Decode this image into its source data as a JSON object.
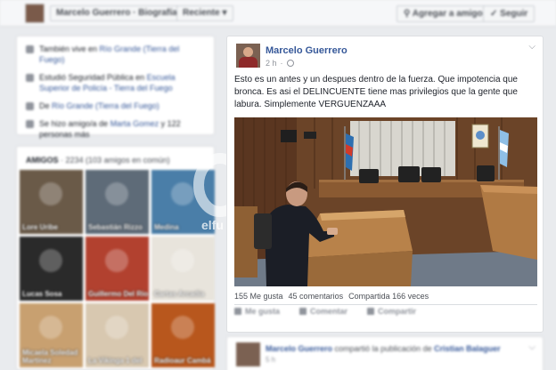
{
  "topbar": {
    "profile_name": "Marcelo Guerrero",
    "section": "Biografía",
    "sort": "Reciente",
    "add_friend": "Agregar a amigos",
    "follow": "Seguir"
  },
  "intro": [
    {
      "pre": "También vive en ",
      "link": "Río Grande (Tierra del Fuego)",
      "post": ""
    },
    {
      "pre": "Estudió Seguridad Pública en ",
      "link": "Escuela Superior de Policía - Tierra del Fuego",
      "post": ""
    },
    {
      "pre": "De ",
      "link": "Río Grande (Tierra del Fuego)",
      "post": ""
    },
    {
      "pre": "Se hizo amigo/a de ",
      "link": "Marta Gomez",
      "post": " y 122 personas más"
    }
  ],
  "friends": {
    "title": "AMIGOS",
    "count": "2234 (103 amigos en común)",
    "items": [
      {
        "name": "Lore Uribe",
        "color": "#6a5a48"
      },
      {
        "name": "Sebastián Rizzo",
        "color": "#5e6b78"
      },
      {
        "name": "Medina",
        "color": "#4a7ea8"
      },
      {
        "name": "Lucas Sosa",
        "color": "#2a2a2a"
      },
      {
        "name": "Guillermo Del Río",
        "color": "#b2412f"
      },
      {
        "name": "Cartas Arcadia",
        "color": "#e8e4dc"
      },
      {
        "name": "Micaela Soledad Martínez",
        "color": "#c8a070"
      },
      {
        "name": "La Vikinga 1 del",
        "color": "#d8c8b0"
      },
      {
        "name": "Radioaur Cambá",
        "color": "#b8571d"
      }
    ]
  },
  "post": {
    "author": "Marcelo Guerrero",
    "time": "2 h",
    "text": "Esto es un antes y un despues dentro de la fuerza. Que impotencia que bronca. Es asi el DELINCUENTE tiene mas privilegios que la gente que labura. Simplemente VERGUENZAAA",
    "likes": "155 Me gusta",
    "comments": "45 comentarios",
    "shares": "Compartida 166 veces",
    "actions": {
      "like": "Me gusta",
      "comment": "Comentar",
      "share": "Compartir"
    }
  },
  "next_post": {
    "author": "Marcelo Guerrero",
    "verb": "compartió la publicación de",
    "target": "Cristian Balaguer",
    "time": "5 h"
  },
  "watermark": "elfueguino"
}
